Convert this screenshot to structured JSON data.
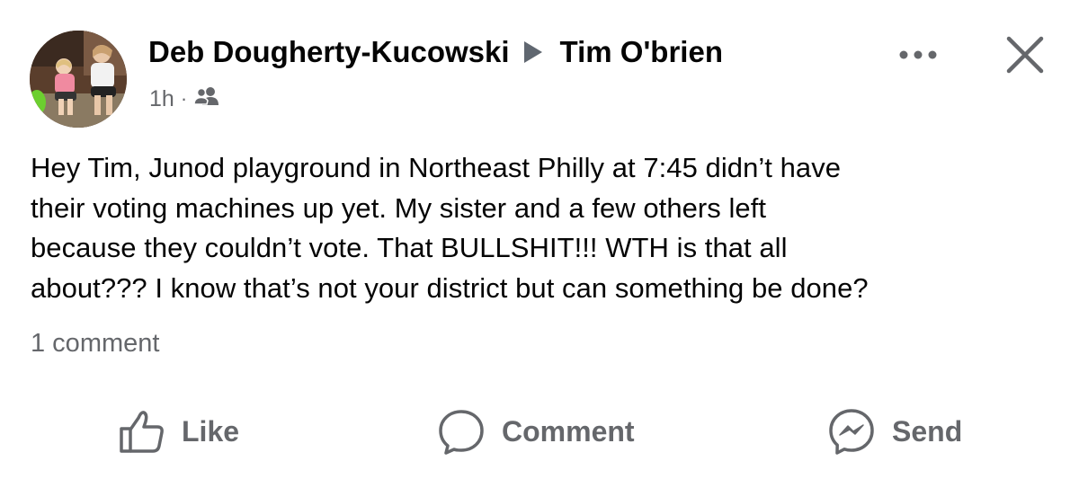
{
  "post": {
    "author": "Deb Dougherty-Kucowski",
    "recipient": "Tim O'brien",
    "time": "1h",
    "separator": "·",
    "audience_icon": "friends-icon",
    "body_lines": [
      "Hey Tim, Junod playground in Northeast Philly at 7:45 didn’t have",
      "their voting machines up yet. My sister and a few others left",
      "because they couldn’t vote. That BULLSHIT!!! WTH is that all",
      "about??? I know that’s not your district but can something be done?"
    ],
    "comment_count": "1 comment"
  },
  "header_actions": {
    "more_icon": "more-options-icon",
    "close_icon": "close-icon"
  },
  "actions": {
    "like": {
      "label": "Like",
      "icon": "thumbs-up-icon"
    },
    "comment": {
      "label": "Comment",
      "icon": "comment-bubble-icon"
    },
    "send": {
      "label": "Send",
      "icon": "messenger-icon"
    }
  },
  "colors": {
    "text_primary": "#050505",
    "text_secondary": "#65676b",
    "background": "#ffffff"
  }
}
